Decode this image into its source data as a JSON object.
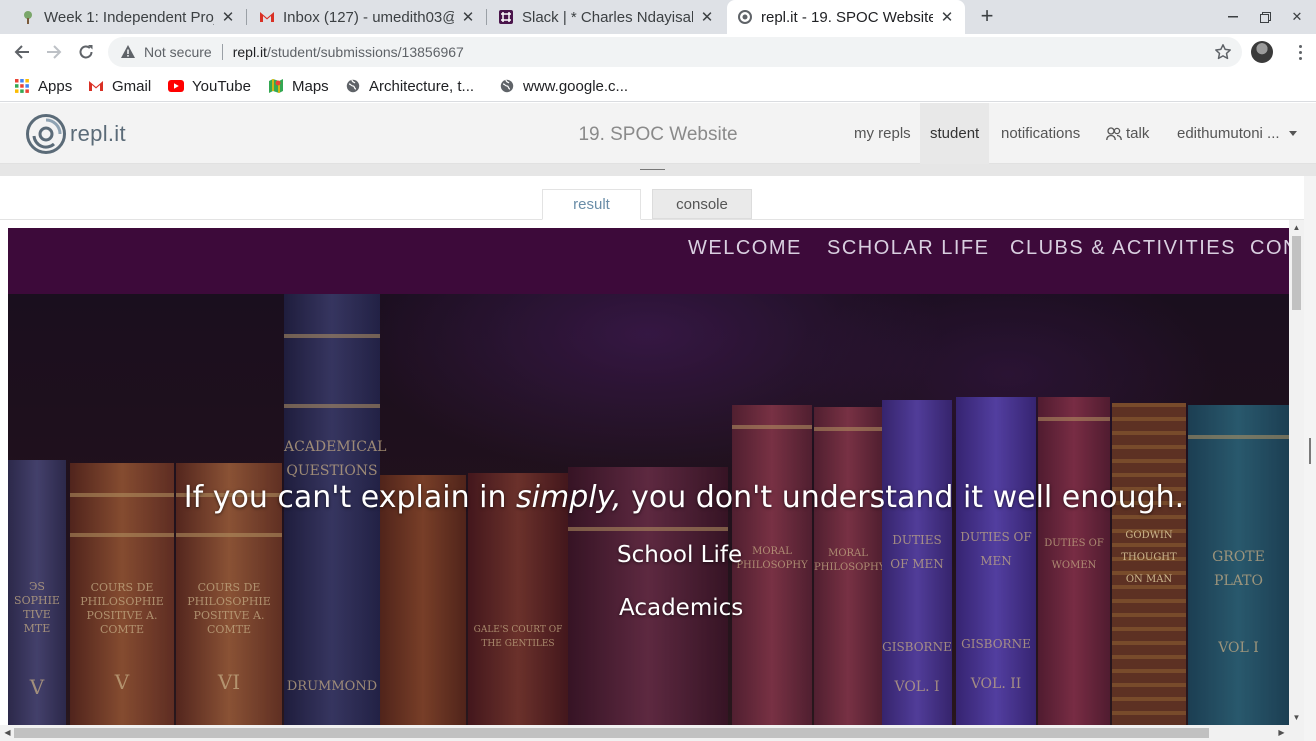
{
  "browser": {
    "tabs": [
      {
        "title": "Week 1: Independent Proj",
        "icon": "tree-favicon",
        "active": false
      },
      {
        "title": "Inbox (127) - umedith03@",
        "icon": "gmail-favicon",
        "active": false
      },
      {
        "title": "Slack | * Charles Ndayisab",
        "icon": "slack-favicon",
        "active": false
      },
      {
        "title": "repl.it - 19. SPOC Website",
        "icon": "replit-favicon",
        "active": true
      }
    ],
    "new_tab": "+",
    "security_label": "Not secure",
    "url_host": "repl.it",
    "url_path": "/student/submissions/13856967",
    "bookmarks": [
      {
        "label": "Apps",
        "icon": "apps-grid-icon"
      },
      {
        "label": "Gmail",
        "icon": "gmail-icon"
      },
      {
        "label": "YouTube",
        "icon": "youtube-icon"
      },
      {
        "label": "Maps",
        "icon": "maps-icon"
      },
      {
        "label": "Architecture, t...",
        "icon": "globe-icon"
      },
      {
        "label": "www.google.c...",
        "icon": "globe-icon"
      }
    ]
  },
  "replit": {
    "logo_text": "repl.it",
    "project_title": "19. SPOC Website",
    "nav": {
      "my_repls": "my repls",
      "student": "student",
      "notifications": "notifications",
      "talk": "talk",
      "user": "edithumutoni ..."
    },
    "tabs": {
      "result": "result",
      "console": "console"
    }
  },
  "site": {
    "nav": [
      "WELCOME",
      "SCHOLAR LIFE",
      "CLUBS & ACTIVITIES",
      "CON"
    ],
    "quote_before": "If you can't explain in ",
    "quote_em": "simply,",
    "quote_after": " you don't understand it well enough.",
    "links": [
      "School Life",
      "Academics"
    ],
    "book_spines": {
      "academical": "ACADEMICAL",
      "questions": "QUESTIONS",
      "cours1": "COURS DE PHILOSOPHIE POSITIVE A. COMTE",
      "cours2": "COURS DE PHILOSOPHIE POSITIVE A. COMTE",
      "vol_v": "V",
      "vol_vi": "VI",
      "drummond": "DRUMMOND",
      "gales": "GALE'S COURT OF THE GENTILES",
      "moral": "MORAL PHILOSOPHY",
      "duties1": "DUTIES OF MEN",
      "duties2": "DUTIES OF MEN",
      "gisborne1": "GISBORNE",
      "gisborne2": "GISBORNE",
      "vol1": "VOL. I",
      "vol2": "VOL. II",
      "duties_women": "DUTIES OF WOMEN",
      "godwin": "GODWIN THOUGHT ON MAN",
      "grote": "GROTE PLATO",
      "grote_vol": "VOL I"
    }
  },
  "colors": {
    "site_nav_bg": "#3d0a3a",
    "replit_header_bg": "#f3f3f3",
    "tab_strip_bg": "#dee1e6"
  }
}
